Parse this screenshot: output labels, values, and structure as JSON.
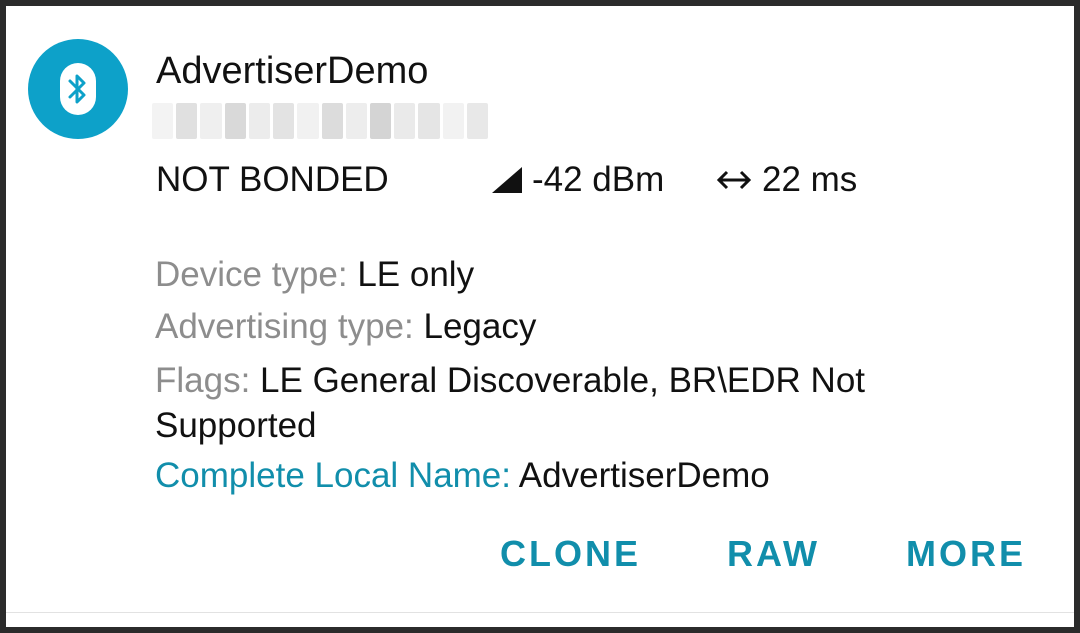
{
  "device": {
    "icon": "bluetooth-icon",
    "name": "AdvertiserDemo",
    "bond_state": "NOT BONDED",
    "rssi": "-42 dBm",
    "interval": "22 ms"
  },
  "details": {
    "device_type_label": "Device type:",
    "device_type_value": "LE only",
    "advertising_type_label": "Advertising type:",
    "advertising_type_value": "Legacy",
    "flags_label": "Flags:",
    "flags_value": "LE General Discoverable, BR\\EDR Not Supported",
    "local_name_label": "Complete Local Name:",
    "local_name_value": "AdvertiserDemo"
  },
  "actions": {
    "clone": "CLONE",
    "raw": "RAW",
    "more": "MORE"
  },
  "colors": {
    "accent": "#118eab",
    "avatar": "#0da1c9",
    "label_grey": "#8d8d8d"
  }
}
